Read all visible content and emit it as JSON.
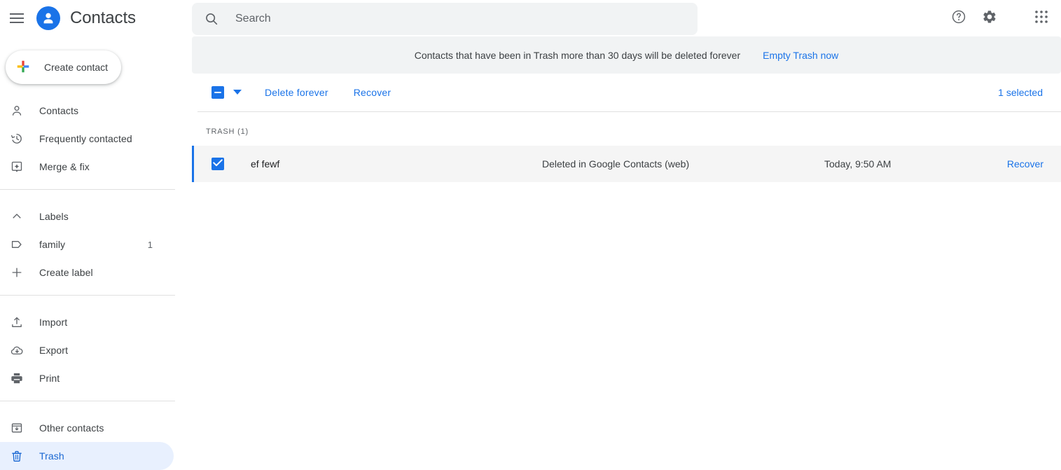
{
  "header": {
    "menu_icon": "hamburger-icon",
    "app_icon": "contacts-avatar-icon",
    "title": "Contacts",
    "help_icon": "help-icon",
    "settings_icon": "gear-icon",
    "apps_icon": "apps-grid-icon"
  },
  "search": {
    "icon": "search-icon",
    "placeholder": "Search",
    "value": ""
  },
  "sidebar": {
    "create_button": {
      "label": "Create contact",
      "icon": "plus-icon"
    },
    "groups": [
      {
        "items": [
          {
            "label": "Contacts",
            "icon": "person-icon",
            "active": false,
            "count": ""
          },
          {
            "label": "Frequently contacted",
            "icon": "history-icon",
            "active": false,
            "count": ""
          },
          {
            "label": "Merge & fix",
            "icon": "merge-fix-icon",
            "active": false,
            "count": ""
          }
        ]
      },
      {
        "items": [
          {
            "label": "Labels",
            "icon": "chevron-up-icon",
            "active": false,
            "count": ""
          },
          {
            "label": "family",
            "icon": "label-tag-icon",
            "active": false,
            "count": "1"
          },
          {
            "label": "Create label",
            "icon": "plus-thin-icon",
            "active": false,
            "count": ""
          }
        ]
      },
      {
        "items": [
          {
            "label": "Import",
            "icon": "import-icon",
            "active": false,
            "count": ""
          },
          {
            "label": "Export",
            "icon": "export-cloud-icon",
            "active": false,
            "count": ""
          },
          {
            "label": "Print",
            "icon": "printer-icon",
            "active": false,
            "count": ""
          }
        ]
      },
      {
        "items": [
          {
            "label": "Other contacts",
            "icon": "other-contacts-icon",
            "active": false,
            "count": ""
          },
          {
            "label": "Trash",
            "icon": "trash-icon",
            "active": true,
            "count": ""
          }
        ]
      }
    ]
  },
  "banner": {
    "text": "Contacts that have been in Trash more than 30 days will be deleted forever",
    "link_label": "Empty Trash now"
  },
  "toolbar": {
    "select_all_state": "indeterminate",
    "caret_icon": "chevron-down-icon",
    "delete_forever_label": "Delete forever",
    "recover_label": "Recover",
    "selected_count_label": "1 selected"
  },
  "list": {
    "section_title": "TRASH (1)",
    "rows": [
      {
        "checked": true,
        "name": "ef fewf",
        "source": "Deleted in Google Contacts (web)",
        "date": "Today, 9:50 AM",
        "action_label": "Recover"
      }
    ]
  },
  "colors": {
    "accent_blue": "#1a73e8",
    "link_blue": "#1967d2",
    "active_pill": "#e8f0fe",
    "row_bg": "#f5f5f5",
    "banner_bg": "#f1f3f4",
    "text_primary": "#202124",
    "text_secondary": "#5f6368"
  }
}
